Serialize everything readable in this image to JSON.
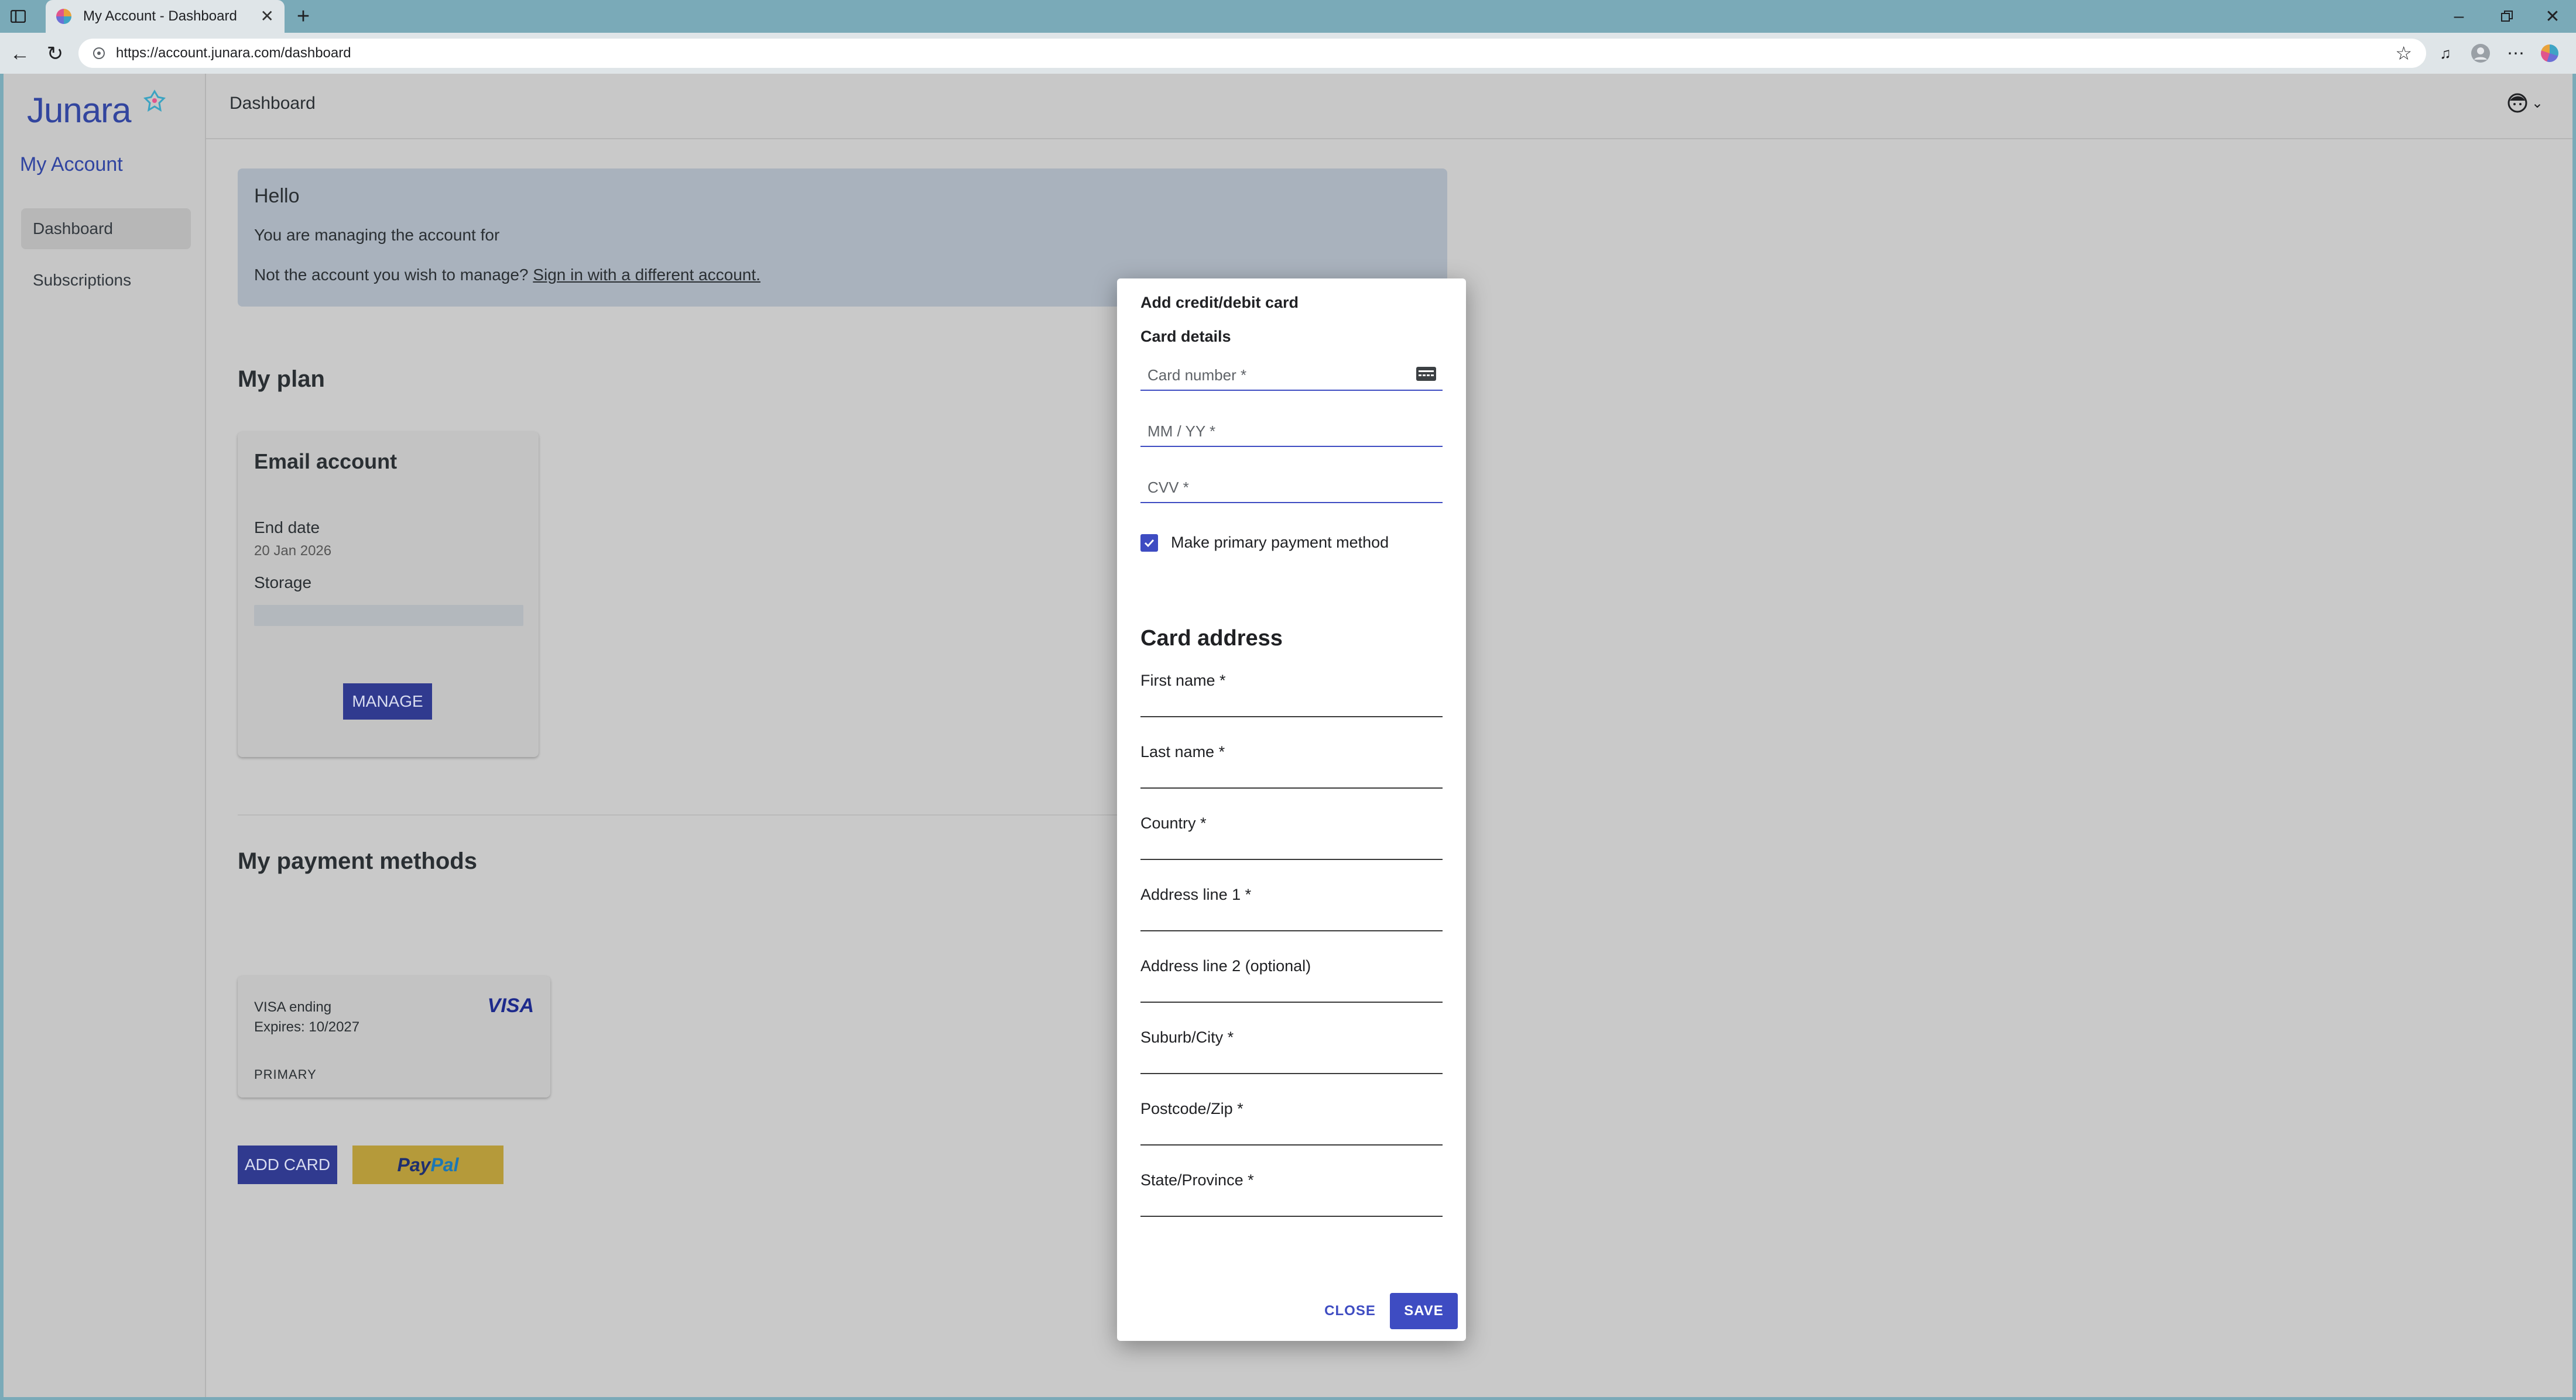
{
  "browser": {
    "tab_title": "My Account - Dashboard",
    "url": "https://account.junara.com/dashboard"
  },
  "sidebar": {
    "logo": "Junara",
    "title": "My Account",
    "items": [
      {
        "label": "Dashboard",
        "active": true
      },
      {
        "label": "Subscriptions",
        "active": false
      }
    ]
  },
  "header": {
    "title": "Dashboard"
  },
  "hello": {
    "heading": "Hello",
    "line1": "You are managing the account for",
    "line2_prefix": "Not the account you wish to manage?",
    "link": "Sign in with a different account."
  },
  "plan": {
    "section_title": "My plan",
    "card_title": "Email account",
    "end_date_label": "End date",
    "end_date_value": "20 Jan 2026",
    "storage_label": "Storage",
    "manage_button": "MANAGE"
  },
  "payments": {
    "section_title": "My payment methods",
    "card_line1": "VISA ending",
    "card_line2": "Expires: 10/2027",
    "card_badge": "PRIMARY",
    "brand": "VISA",
    "add_card_button": "ADD CARD",
    "paypal_a": "Pay",
    "paypal_b": "Pal"
  },
  "dialog": {
    "title": "Add credit/debit card",
    "card_details": "Card details",
    "card_number_placeholder": "Card number *",
    "expiry_placeholder": "MM / YY *",
    "cvv_placeholder": "CVV *",
    "primary_checkbox_label": "Make primary payment method",
    "primary_checked": true,
    "address_heading": "Card address",
    "fields": {
      "first_name": "First name *",
      "last_name": "Last name *",
      "country": "Country *",
      "address1": "Address line 1 *",
      "address2": "Address line 2 (optional)",
      "city": "Suburb/City *",
      "postcode": "Postcode/Zip *",
      "state": "State/Province *"
    },
    "close_button": "CLOSE",
    "save_button": "SAVE"
  },
  "colors": {
    "accent": "#3e4cc2",
    "brand": "#32459e",
    "overlay_button": "#303a8f"
  }
}
